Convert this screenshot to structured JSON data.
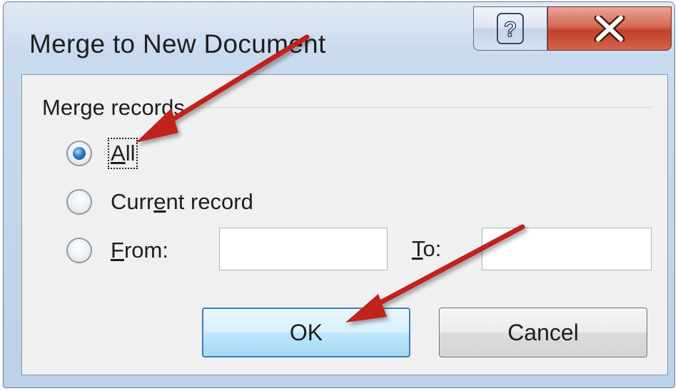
{
  "window": {
    "title": "Merge to New Document",
    "help_icon": "question-mark-icon",
    "close_icon": "close-x-icon"
  },
  "group": {
    "label": "Merge records"
  },
  "options": {
    "all": {
      "label": "All",
      "accesskey": "A",
      "rest": "ll",
      "checked": true
    },
    "current": {
      "pre": "Curr",
      "accesskey": "e",
      "post": "nt record",
      "checked": false
    },
    "from": {
      "accesskey": "F",
      "rest": "rom:",
      "checked": false
    }
  },
  "fields": {
    "from_value": "",
    "to_label_key": "T",
    "to_label_rest": "o:",
    "to_value": ""
  },
  "buttons": {
    "ok": "OK",
    "cancel": "Cancel"
  },
  "colors": {
    "arrow": "#c0201c",
    "close_button": "#c94a33",
    "default_button_border": "#3c7fb1",
    "radio_checked": "#2f7fc6"
  }
}
